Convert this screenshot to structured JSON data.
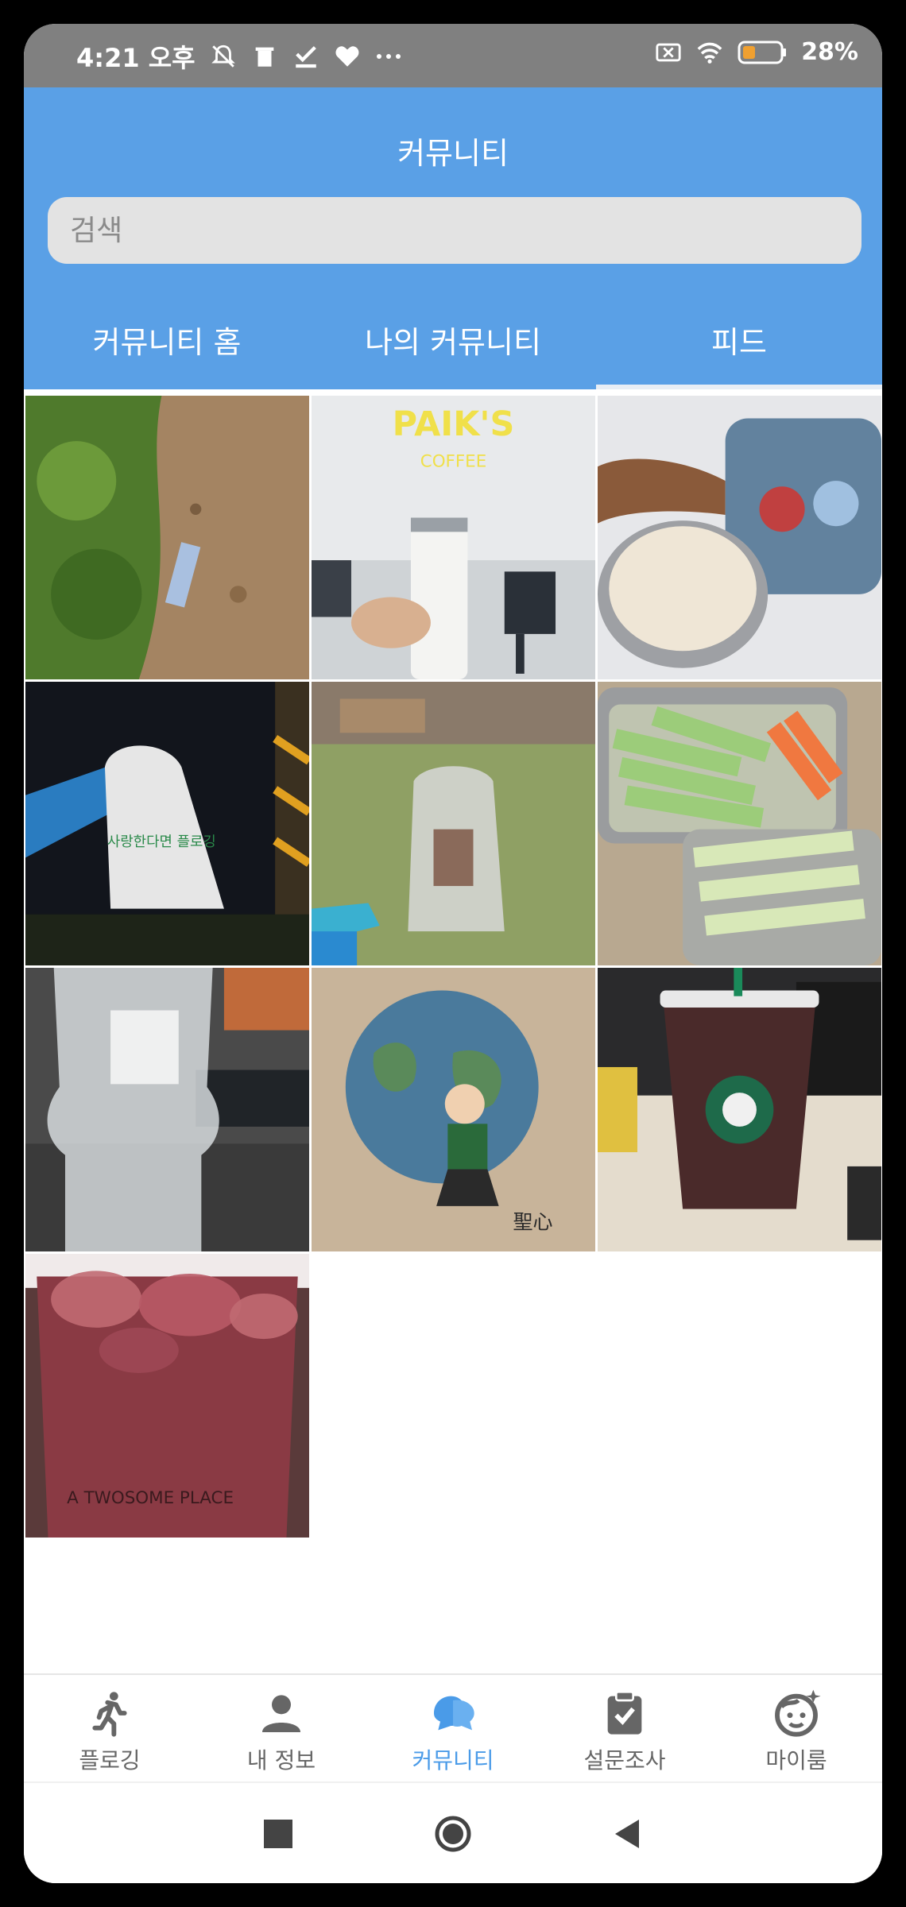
{
  "status_bar": {
    "time": "4:21 오후",
    "battery": "28%",
    "icons": [
      "mute-icon",
      "trash-icon",
      "check-icon",
      "heart-icon",
      "more-icon",
      "no-sim-icon",
      "wifi-icon",
      "battery-icon"
    ]
  },
  "header": {
    "title": "커뮤니티",
    "search_placeholder": "검색"
  },
  "tabs": [
    {
      "label": "커뮤니티 홈",
      "active": false
    },
    {
      "label": "나의 커뮤니티",
      "active": false
    },
    {
      "label": "피드",
      "active": true
    }
  ],
  "feed": {
    "photos": [
      "grass-and-dirt-photo",
      "paiks-coffee-tumbler-photo",
      "cream-container-photo",
      "plogging-bag-night-photo",
      "plastic-bag-on-grass-photo",
      "cucumber-carrot-lunchbox-photo",
      "plastic-bottle-photo",
      "paper-bag-earth-photo",
      "starbucks-cup-photo",
      "iced-drink-photo"
    ]
  },
  "bottom_nav": [
    {
      "label": "플로깅",
      "icon": "running-icon",
      "active": false
    },
    {
      "label": "내 정보",
      "icon": "person-icon",
      "active": false
    },
    {
      "label": "커뮤니티",
      "icon": "chat-bubbles-icon",
      "active": true
    },
    {
      "label": "설문조사",
      "icon": "clipboard-check-icon",
      "active": false
    },
    {
      "label": "마이룸",
      "icon": "face-icon",
      "active": false
    }
  ],
  "colors": {
    "header": "#5aa0e6",
    "active_nav": "#4a9be8",
    "inactive_nav": "#666666",
    "status_bar": "#808080"
  }
}
